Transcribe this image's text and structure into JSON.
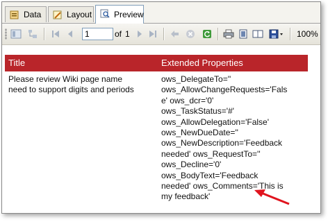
{
  "tabs": [
    {
      "label": "Data",
      "icon": "data-icon"
    },
    {
      "label": "Layout",
      "icon": "layout-icon"
    },
    {
      "label": "Preview",
      "icon": "preview-icon"
    }
  ],
  "toolbar": {
    "page_value": "1",
    "page_of_label": "of",
    "page_total": "1",
    "zoom": "100%"
  },
  "report": {
    "header_color": "#b9252a",
    "columns": [
      "Title",
      "Extended Properties"
    ],
    "title_lines": [
      "Please review Wiki page name",
      "need to support digits and periods"
    ],
    "extended_lines": [
      "ows_DelegateTo=''",
      "ows_AllowChangeRequests='Fals",
      "e' ows_dcr='0'",
      "ows_TaskStatus='#'",
      "ows_AllowDelegation='False'",
      "ows_NewDueDate=''",
      "ows_NewDescription='Feedback",
      "needed' ows_RequestTo=''",
      "ows_Decline='0'",
      "ows_BodyText='Feedback",
      "needed' ows_Comments='This is",
      "my feedback'"
    ]
  },
  "annotation_color": "#e0141e"
}
